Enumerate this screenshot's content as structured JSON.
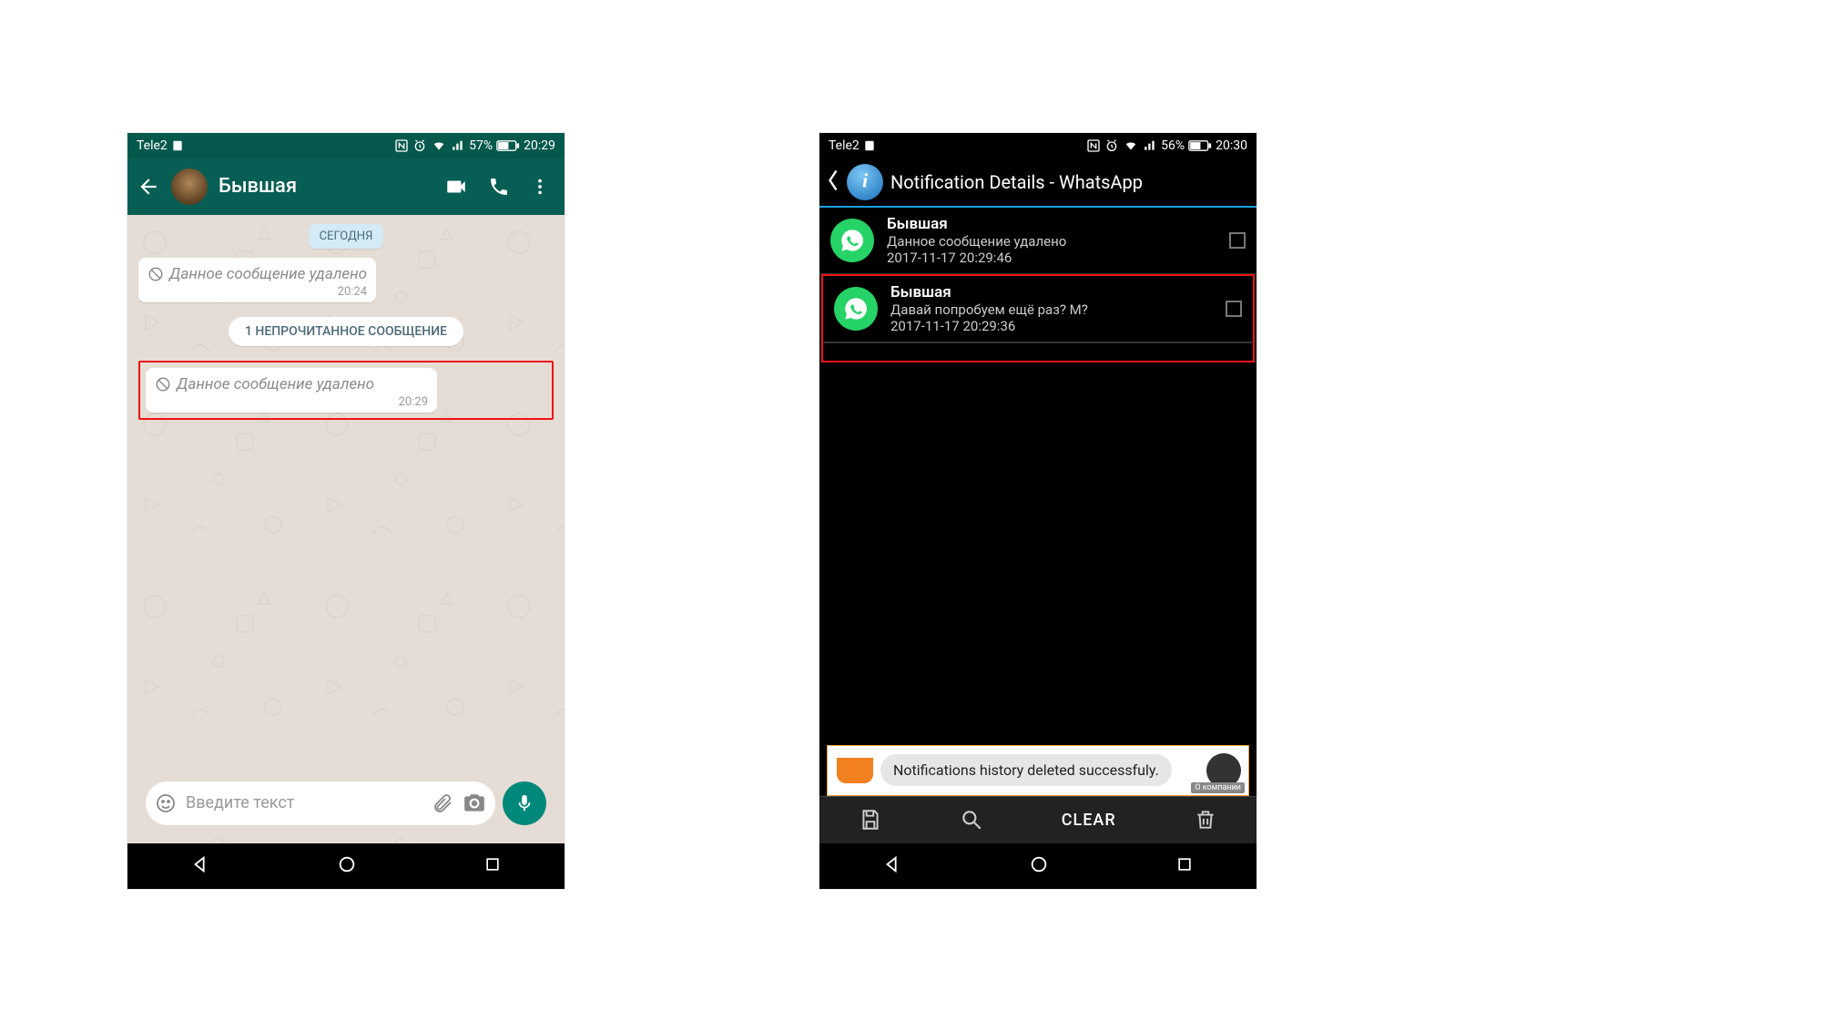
{
  "phone1": {
    "status": {
      "carrier": "Tele2",
      "battery": "57%",
      "time": "20:29"
    },
    "chat": {
      "contact_name": "Бывшая",
      "date_label": "СЕГОДНЯ",
      "messages": [
        {
          "text": "Данное сообщение удалено",
          "time": "20:24"
        },
        {
          "text": "Данное сообщение удалено",
          "time": "20:29"
        }
      ],
      "unread_label": "1 НЕПРОЧИТАННОЕ СООБЩЕНИЕ",
      "input_placeholder": "Введите текст"
    }
  },
  "phone2": {
    "status": {
      "carrier": "Tele2",
      "battery": "56%",
      "time": "20:30"
    },
    "header_title": "Notification Details - WhatsApp",
    "notifications": [
      {
        "title": "Бывшая",
        "body": "Данное сообщение удалено",
        "ts": "2017-11-17 20:29:46"
      },
      {
        "title": "Бывшая",
        "body": "Давай попробуем ещё раз? М?",
        "ts": "2017-11-17 20:29:36"
      }
    ],
    "toast": "Notifications history deleted successfuly.",
    "ad_tag": "О компании",
    "footer": {
      "clear": "CLEAR"
    }
  }
}
